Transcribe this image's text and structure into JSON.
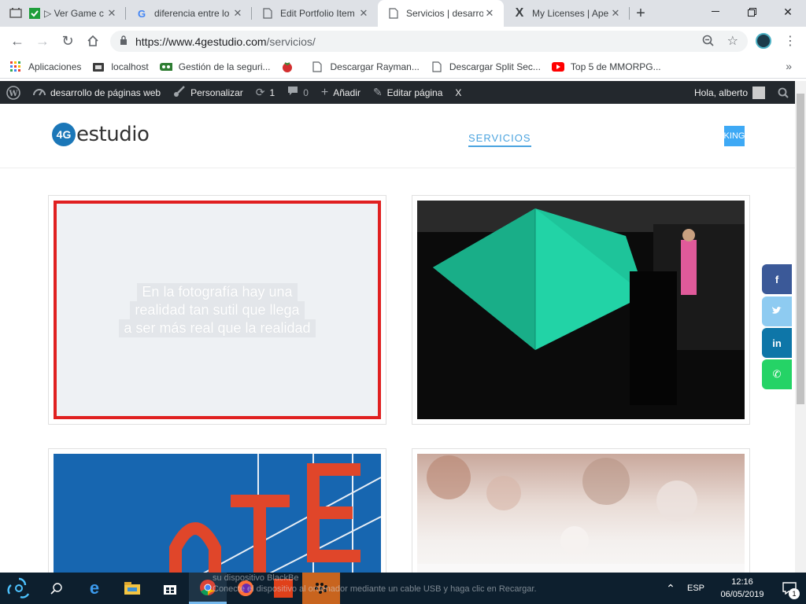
{
  "browser": {
    "tabs": [
      {
        "title": "▷ Ver Game c",
        "icon": "film-icon"
      },
      {
        "title": "diferencia entre lo",
        "icon": "google-icon"
      },
      {
        "title": "Edit Portfolio Item",
        "icon": "document-icon"
      },
      {
        "title": "Servicios | desarro",
        "icon": "document-icon",
        "active": true
      },
      {
        "title": "My Licenses | Ape",
        "icon": "x-logo-icon"
      }
    ],
    "url_host": "https://www.4gestudio.com",
    "url_path": "/servicios/",
    "bookmarks": [
      {
        "label": "Aplicaciones",
        "icon": "apps-grid-icon"
      },
      {
        "label": "localhost",
        "icon": "folder-icon"
      },
      {
        "label": "Gestión de la seguri...",
        "icon": "badge-icon"
      },
      {
        "label": "",
        "icon": "tomato-icon"
      },
      {
        "label": "Descargar Rayman...",
        "icon": "document-icon"
      },
      {
        "label": "Descargar Split Sec...",
        "icon": "document-icon"
      },
      {
        "label": "Top 5 de MMORPG...",
        "icon": "youtube-icon"
      }
    ],
    "more_bookmarks": "»"
  },
  "wp_admin_bar": {
    "site_name": "desarrollo de páginas web",
    "customize": "Personalizar",
    "updates": "1",
    "comments": "0",
    "add_new": "Añadir",
    "edit_page": "Editar página",
    "x": "X",
    "greeting": "Hola, alberto"
  },
  "site": {
    "logo_badge": "4G",
    "logo_word": "estudio",
    "nav_active": "SERVICIOS",
    "nav_partial": "KING"
  },
  "portfolio": {
    "quote_lines": [
      "En la fotografía hay una",
      "realidad tan sutil que llega",
      "a ser más real que la realidad"
    ]
  },
  "social": [
    {
      "icon": "facebook-icon",
      "glyph": "f",
      "color": "#3b5998"
    },
    {
      "icon": "twitter-icon",
      "glyph": "🐦",
      "color": "#8ecbf1"
    },
    {
      "icon": "linkedin-icon",
      "glyph": "in",
      "color": "#0e76a8"
    },
    {
      "icon": "whatsapp-icon",
      "glyph": "✆",
      "color": "#25d366"
    }
  ],
  "taskbar": {
    "notification_line1": "su dispositivo BlackBe",
    "notification_line2": "Conecte el dispositivo al ordenador mediante un cable USB y haga clic en Recargar.",
    "language": "ESP",
    "time": "12:16",
    "date": "06/05/2019",
    "notif_count": "1"
  }
}
